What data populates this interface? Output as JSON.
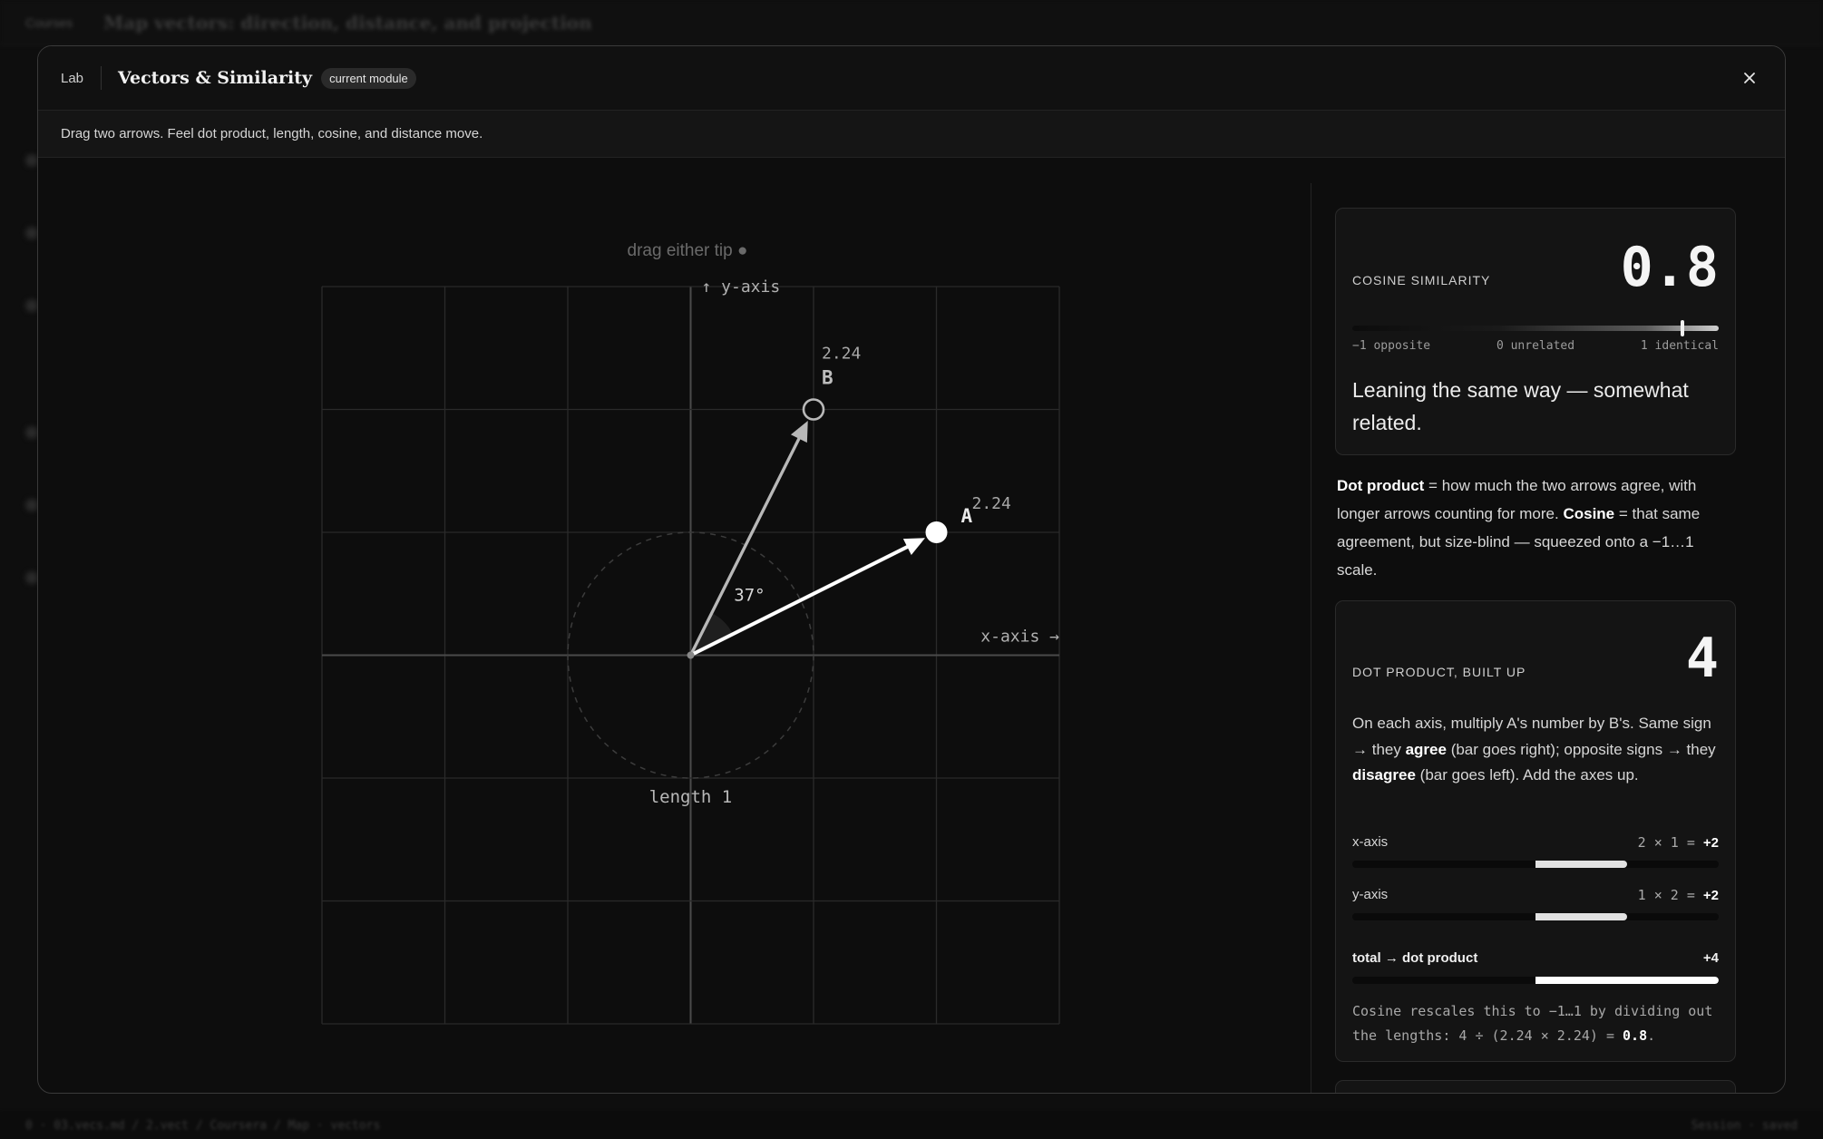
{
  "background": {
    "breadcrumb": "Courses",
    "page_title": "Map vectors: direction, distance, and projection",
    "status_left": "0 · 03.vecs.md / 2.vect / Coursera / Map · vectors",
    "status_right": "Session · saved"
  },
  "modal": {
    "kind": "Lab",
    "title": "Vectors & Similarity",
    "badge": "current module",
    "subtitle": "Drag two arrows. Feel dot product, length, cosine, and distance move."
  },
  "plot": {
    "hint": "drag either tip ●",
    "y_axis_label": "↑ y-axis",
    "x_axis_label": "x-axis →",
    "unit_circle_label": "length 1",
    "angle_label": "37°",
    "vectors": [
      {
        "name": "A",
        "x": 2,
        "y": 1,
        "length_label": "2.24"
      },
      {
        "name": "B",
        "x": 1,
        "y": 2,
        "length_label": "2.24"
      }
    ],
    "x_range": [
      -3,
      3
    ],
    "y_range": [
      -3,
      3
    ],
    "grid": true,
    "colors": {
      "vector_a": "#ffffff",
      "vector_b": "#b8b8b8",
      "grid": "#2a2a2a",
      "axis": "#4a4a4a"
    }
  },
  "cosine": {
    "label": "Cosine similarity",
    "value_text": "0.8",
    "value": 0.8,
    "tick_left": "−1 opposite",
    "tick_mid": "0 unrelated",
    "tick_right": "1 identical",
    "description": "Leaning the same way — somewhat related."
  },
  "explain": {
    "dot_term": "Dot product",
    "dot_text": " = how much the two arrows agree, with longer arrows counting for more. ",
    "cos_term": "Cosine",
    "cos_text": " = that same agreement, but size-blind — squeezed onto a −1…1 scale."
  },
  "dot_product": {
    "label": "Dot product, built up",
    "value_text": "4",
    "desc_1": "On each axis, multiply A's number by B's. Same sign → they ",
    "agree": "agree",
    "desc_2": " (bar goes right); opposite signs → they ",
    "disagree": "disagree",
    "desc_3": " (bar goes left). Add the axes up.",
    "rows": [
      {
        "name": "x-axis",
        "expr": "2 × 1 = ",
        "result": "+2",
        "value": 2
      },
      {
        "name": "y-axis",
        "expr": "1 × 2 = ",
        "result": "+2",
        "value": 2
      }
    ],
    "total": {
      "name": "total → dot product",
      "result": "+4",
      "value": 4
    },
    "bar_max": 4,
    "foot_1": "Cosine rescales this to −1…1 by dividing out the lengths: 4 ÷ (2.24 × 2.24) = ",
    "foot_val": "0.8",
    "foot_end": "."
  }
}
